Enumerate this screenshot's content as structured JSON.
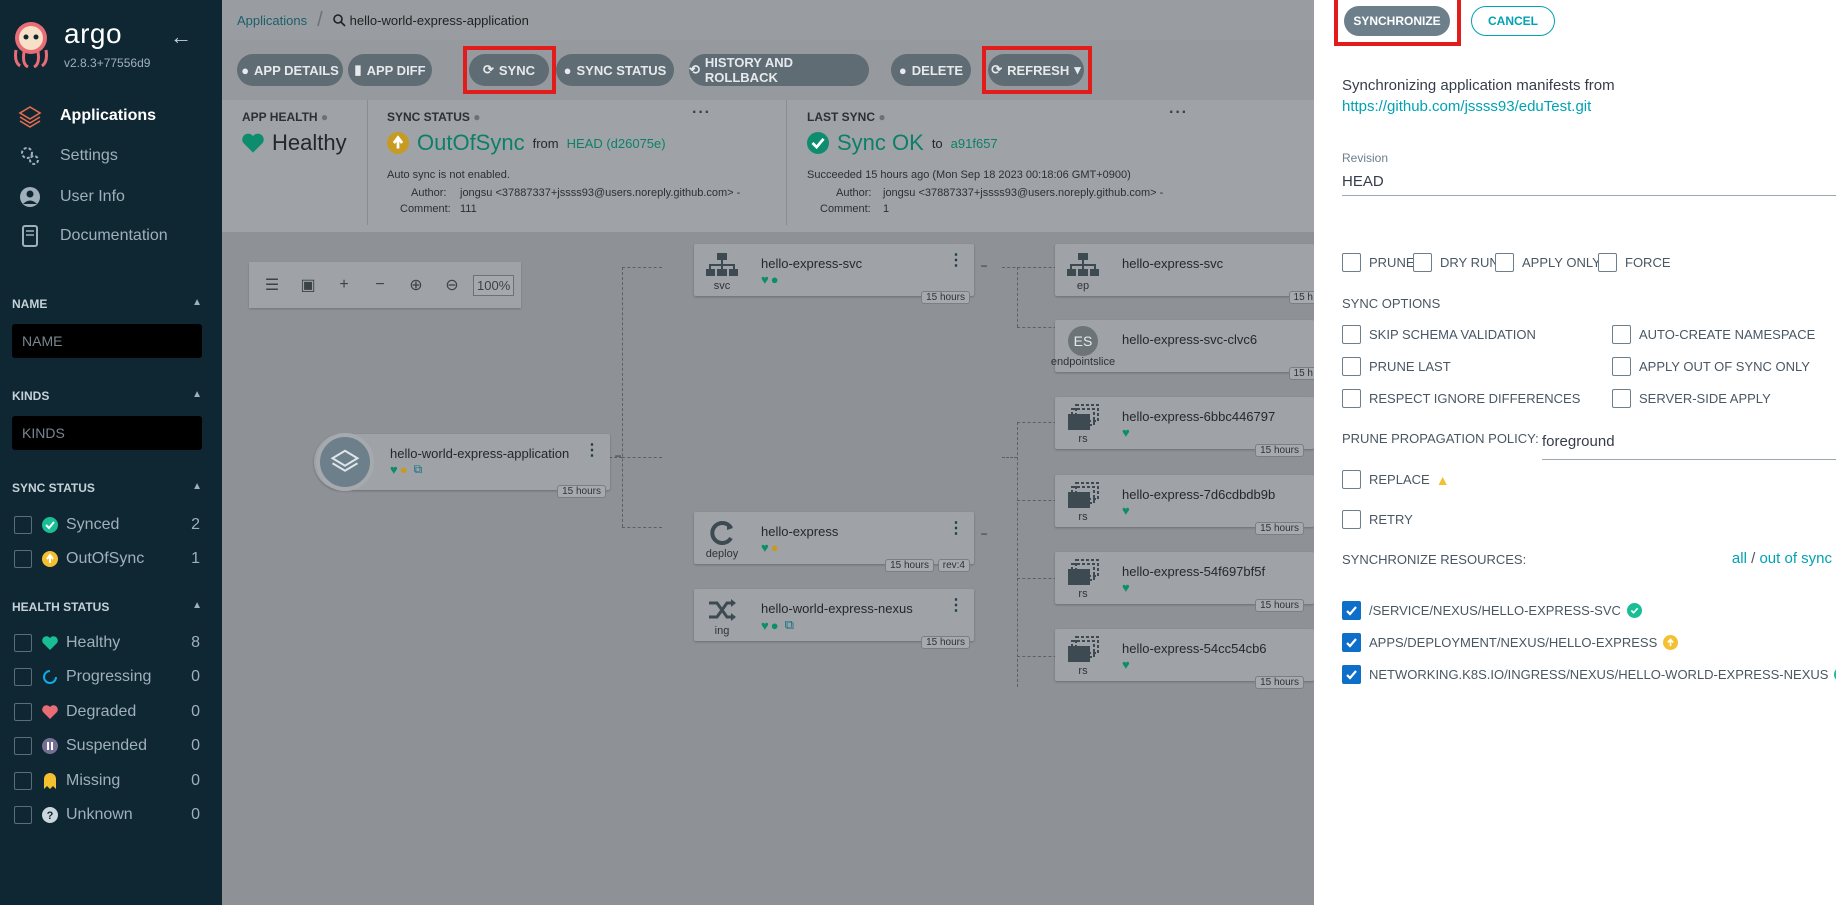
{
  "app": {
    "name": "argo",
    "version": "v2.8.3+77556d9"
  },
  "nav": [
    {
      "label": "Applications",
      "icon": "layers-icon",
      "active": true
    },
    {
      "label": "Settings",
      "icon": "gears-icon"
    },
    {
      "label": "User Info",
      "icon": "user-icon"
    },
    {
      "label": "Documentation",
      "icon": "book-icon"
    }
  ],
  "filters": {
    "name": {
      "label": "NAME",
      "placeholder": "NAME"
    },
    "kinds": {
      "label": "KINDS",
      "placeholder": "KINDS"
    },
    "sync_status": {
      "label": "SYNC STATUS",
      "items": [
        {
          "label": "Synced",
          "count": "2"
        },
        {
          "label": "OutOfSync",
          "count": "1"
        }
      ]
    },
    "health_status": {
      "label": "HEALTH STATUS",
      "items": [
        {
          "label": "Healthy",
          "count": "8"
        },
        {
          "label": "Progressing",
          "count": "0"
        },
        {
          "label": "Degraded",
          "count": "0"
        },
        {
          "label": "Suspended",
          "count": "0"
        },
        {
          "label": "Missing",
          "count": "0"
        },
        {
          "label": "Unknown",
          "count": "0"
        }
      ]
    }
  },
  "breadcrumb": {
    "root": "Applications",
    "current": "hello-world-express-application"
  },
  "toolbar": {
    "app_details": "APP DETAILS",
    "app_diff": "APP DIFF",
    "sync": "SYNC",
    "sync_status": "SYNC STATUS",
    "history": "HISTORY AND ROLLBACK",
    "delete": "DELETE",
    "refresh": "REFRESH"
  },
  "status": {
    "health_label": "APP HEALTH",
    "health_value": "Healthy",
    "sync_label": "SYNC STATUS",
    "sync_value": "OutOfSync",
    "sync_from": "from",
    "sync_rev": "HEAD (d26075e)",
    "auto_sync": "Auto sync is not enabled.",
    "author_label": "Author:",
    "author": "jongsu <37887337+jssss93@users.noreply.github.com> -",
    "comment_label": "Comment:",
    "comment": "111",
    "last_label": "LAST SYNC",
    "last_value": "Sync OK",
    "last_to": "to",
    "last_rev": "a91f657",
    "last_when": "Succeeded 15 hours ago (Mon Sep 18 2023 00:18:06 GMT+0900)",
    "last_author": "jongsu <37887337+jssss93@users.noreply.github.com> -",
    "last_comment": "1"
  },
  "zoom": "100%",
  "nodes": {
    "app": {
      "name": "hello-world-express-application",
      "age": "15 hours"
    },
    "svc": {
      "name": "hello-express-svc",
      "kind": "svc",
      "age": "15 hours"
    },
    "deploy": {
      "name": "hello-express",
      "kind": "deploy",
      "age": "15 hours",
      "rev": "rev:4"
    },
    "ing": {
      "name": "hello-world-express-nexus",
      "kind": "ing",
      "age": "15 hours"
    },
    "ep": {
      "name": "hello-express-svc",
      "kind": "ep",
      "age": "15 h"
    },
    "es": {
      "name": "hello-express-svc-clvc6",
      "kind": "endpointslice",
      "age": "15 h",
      "badge": "ES"
    },
    "rs1": {
      "name": "hello-express-6bbc446797",
      "kind": "rs",
      "age": "15 hours"
    },
    "rs2": {
      "name": "hello-express-7d6cdbdb9b",
      "kind": "rs",
      "age": "15 hours"
    },
    "rs3": {
      "name": "hello-express-54f697bf5f",
      "kind": "rs",
      "age": "15 hours"
    },
    "rs4": {
      "name": "hello-express-54cc54cb6",
      "kind": "rs",
      "age": "15 hours"
    }
  },
  "panel": {
    "synchronize": "SYNCHRONIZE",
    "cancel": "CANCEL",
    "intro": "Synchronizing application manifests from",
    "repo_url": "https://github.com/jssss93/eduTest.git",
    "revision_label": "Revision",
    "revision_value": "HEAD",
    "options": {
      "prune": "PRUNE",
      "dry_run": "DRY RUN",
      "apply_only": "APPLY ONLY",
      "force": "FORCE"
    },
    "sync_options_label": "SYNC OPTIONS",
    "sync_options": {
      "skip_schema": "SKIP SCHEMA VALIDATION",
      "auto_ns": "AUTO-CREATE NAMESPACE",
      "prune_last": "PRUNE LAST",
      "apply_oos": "APPLY OUT OF SYNC ONLY",
      "respect_ignore": "RESPECT IGNORE DIFFERENCES",
      "server_side": "SERVER-SIDE APPLY"
    },
    "prune_policy_label": "PRUNE PROPAGATION POLICY:",
    "prune_policy_value": "foreground",
    "replace": "REPLACE",
    "retry": "RETRY",
    "resources_label": "SYNCHRONIZE RESOURCES:",
    "select_all": "all",
    "select_sep": "/",
    "select_oos": "out of sync",
    "resources": [
      "/SERVICE/NEXUS/HELLO-EXPRESS-SVC",
      "APPS/DEPLOYMENT/NEXUS/HELLO-EXPRESS",
      "NETWORKING.K8S.IO/INGRESS/NEXUS/HELLO-WORLD-EXPRESS-NEXUS"
    ]
  },
  "colors": {
    "healthy": "#18be94",
    "outofsync": "#f4c030",
    "accent": "#00a2b3",
    "highlight": "#e21b1b"
  }
}
